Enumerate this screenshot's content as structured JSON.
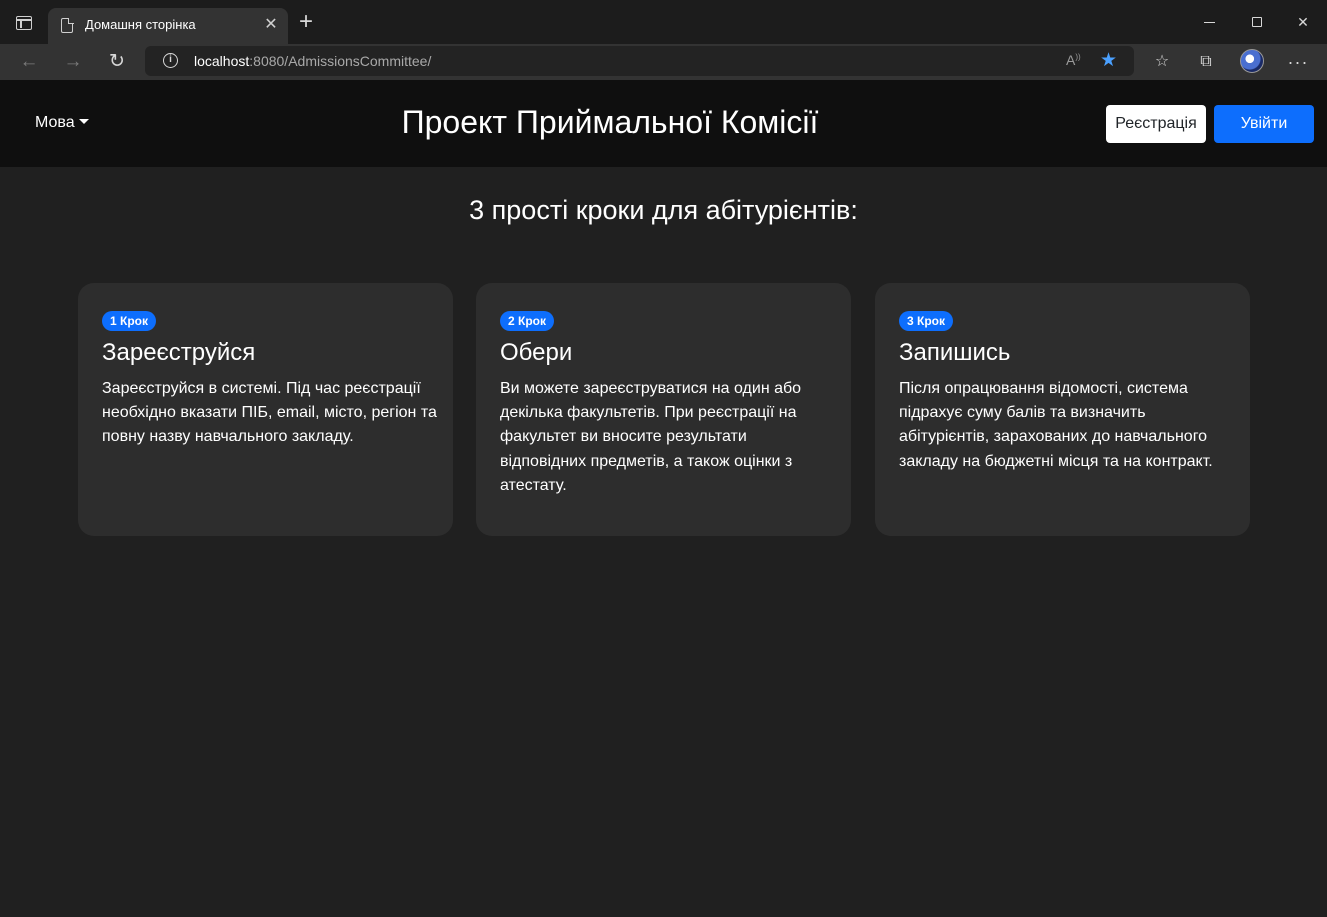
{
  "browser": {
    "tab_title": "Домашня сторінка",
    "url_host": "localhost",
    "url_rest": ":8080/AdmissionsCommittee/",
    "accent_color": "#4aa0ff"
  },
  "nav": {
    "language_label": "Мова",
    "site_title": "Проект Приймальної Комісії",
    "register_label": "Реєстрація",
    "login_label": "Увійти"
  },
  "main": {
    "heading": "3 прості кроки для абітурієнтів:",
    "steps": [
      {
        "badge": "1 Крок",
        "title": "Зареєструйся",
        "text": "Зареєструйся в системі. Під час реєстрації необхідно вказати ПІБ, email, місто, регіон та повну назву навчального закладу."
      },
      {
        "badge": "2 Крок",
        "title": "Обери",
        "text": "Ви можете зареєструватися на один або декілька факультетів. При реєстрації на факультет ви вносите результати відповідних предметів, а також оцінки з атестату."
      },
      {
        "badge": "3 Крок",
        "title": "Запишись",
        "text": "Після опрацювання відомості, система підрахує суму балів та визначить абітурієнтів, зарахованих до навчального закладу на бюджетні місця та на контракт."
      }
    ]
  },
  "colors": {
    "primary": "#0d6efd",
    "page_bg": "#202020",
    "navbar_bg": "#0f0f0f",
    "card_bg": "#2d2d2d"
  },
  "icons": [
    "tab-actions-icon",
    "document-icon",
    "close-icon",
    "plus-icon",
    "minimize-icon",
    "maximize-icon",
    "back-arrow-icon",
    "forward-arrow-icon",
    "reload-icon",
    "info-icon",
    "read-aloud-icon",
    "star-icon",
    "favorites-icon",
    "collections-icon",
    "more-icon"
  ]
}
